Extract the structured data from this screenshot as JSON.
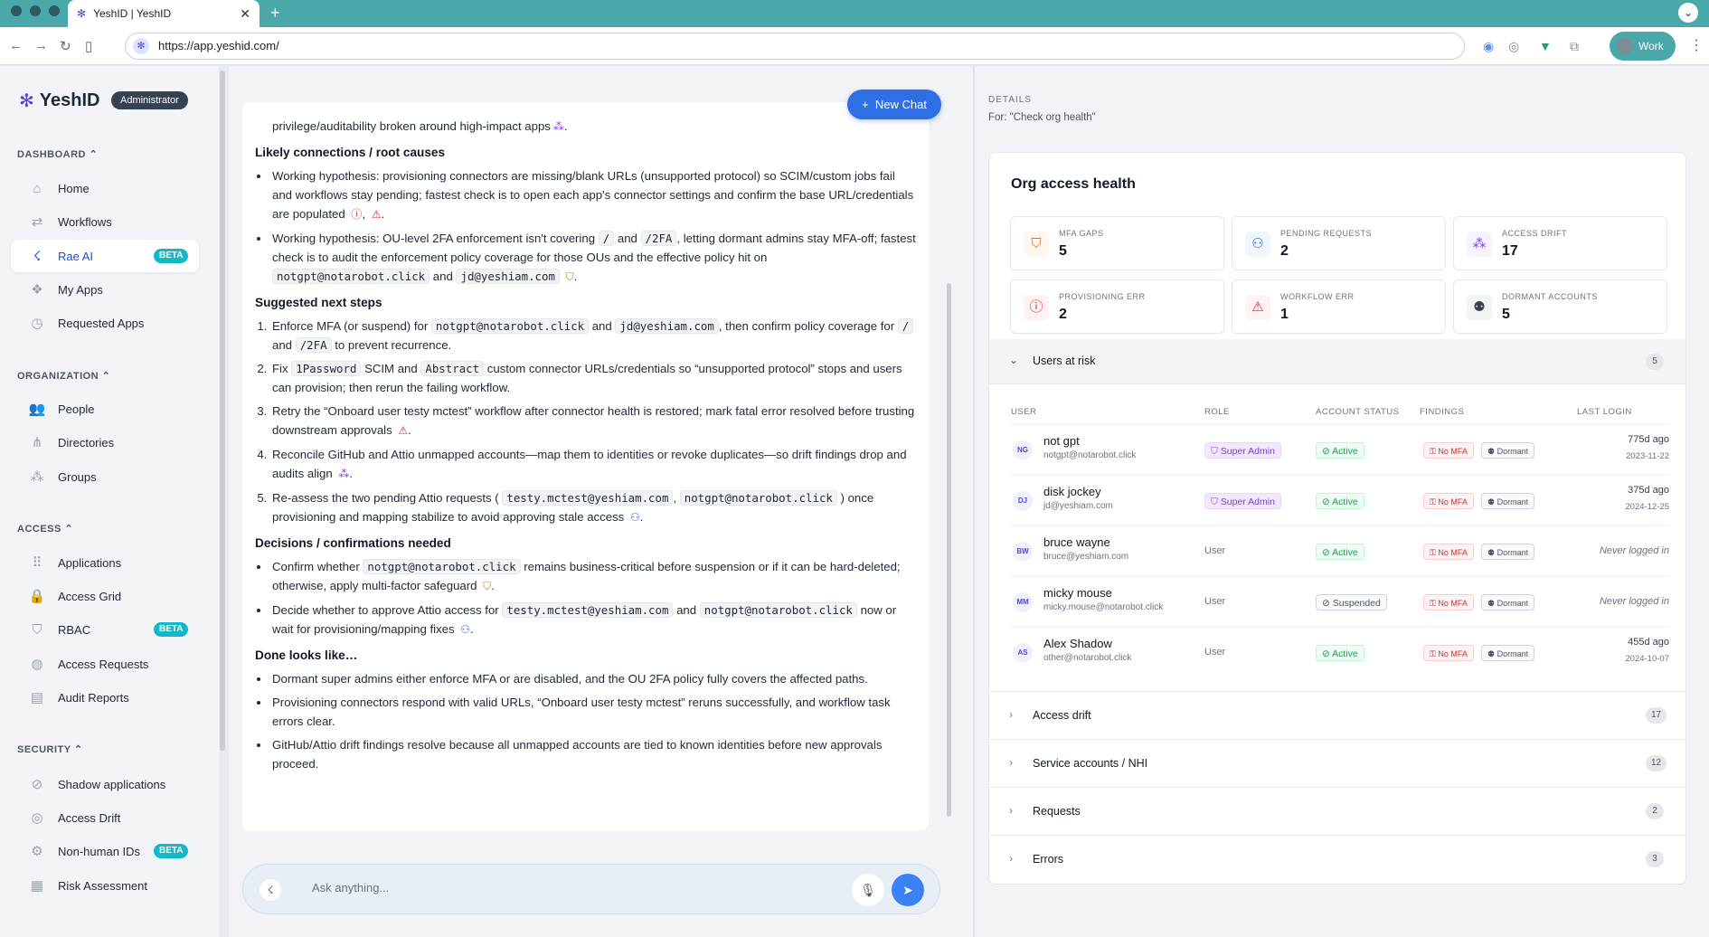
{
  "browser": {
    "tab_title": "YeshID | YeshID",
    "url": "https://app.yeshid.com/",
    "profile": "Work"
  },
  "sidebar": {
    "logo": "YeshID",
    "role": "Administrator",
    "sections": [
      {
        "title": "DASHBOARD",
        "items": [
          {
            "label": "Home"
          },
          {
            "label": "Workflows"
          },
          {
            "label": "Rae AI",
            "badge": "BETA",
            "active": true
          },
          {
            "label": "My Apps"
          },
          {
            "label": "Requested Apps"
          }
        ]
      },
      {
        "title": "ORGANIZATION",
        "items": [
          {
            "label": "People"
          },
          {
            "label": "Directories"
          },
          {
            "label": "Groups"
          }
        ]
      },
      {
        "title": "ACCESS",
        "items": [
          {
            "label": "Applications"
          },
          {
            "label": "Access Grid"
          },
          {
            "label": "RBAC",
            "badge": "BETA"
          },
          {
            "label": "Access Requests"
          },
          {
            "label": "Audit Reports"
          }
        ]
      },
      {
        "title": "SECURITY",
        "items": [
          {
            "label": "Shadow applications"
          },
          {
            "label": "Access Drift"
          },
          {
            "label": "Non-human IDs",
            "badge": "BETA"
          },
          {
            "label": "Risk Assessment"
          }
        ]
      }
    ]
  },
  "chat": {
    "new_chat": "New Chat",
    "placeholder": "Ask anything...",
    "first_line": "privilege/auditability broken around high-impact apps",
    "h1": "Likely connections / root causes",
    "h2": "Suggested next steps",
    "h3": "Decisions / confirmations needed",
    "h4": "Done looks like…",
    "c1": {
      "a": "Working hypothesis: provisioning connectors are missing/blank URLs (unsupported protocol) so SCIM/custom jobs fail and workflows stay pending; fastest check is to open each app's connector settings and confirm the base URL/credentials are populated"
    },
    "c2": {
      "a": "Working hypothesis: OU-level 2FA enforcement isn't covering",
      "k1": "/",
      "and": "and",
      "k2": "/2FA",
      "b": ", letting dormant admins stay MFA-off; fastest check is to audit the enforcement policy coverage for those OUs and the effective policy hit on",
      "k3": "notgpt@notarobot.click",
      "k4": "jd@yeshiam.com"
    },
    "s1": {
      "a": "Enforce MFA (or suspend) for",
      "k1": "notgpt@notarobot.click",
      "and": "and",
      "k2": "jd@yeshiam.com",
      "b": ", then confirm policy coverage for",
      "k3": "/",
      "k4": "/2FA",
      "c": "to prevent recurrence."
    },
    "s2": {
      "a": "Fix",
      "k1": "1Password",
      "b": "SCIM and",
      "k2": "Abstract",
      "c": "custom connector URLs/credentials so “unsupported protocol” stops and users can provision; then rerun the failing workflow."
    },
    "s3": {
      "a": "Retry the “Onboard user testy mctest” workflow after connector health is restored; mark fatal error resolved before trusting downstream approvals"
    },
    "s4": {
      "a": "Reconcile GitHub and Attio unmapped accounts—map them to identities or revoke duplicates—so drift findings drop and audits align"
    },
    "s5": {
      "a": "Re-assess the two pending Attio requests (",
      "k1": "testy.mctest@yeshiam.com",
      "k2": "notgpt@notarobot.click",
      "b": ") once provisioning and mapping stabilize to avoid approving stale access"
    },
    "d1": {
      "a": "Confirm whether",
      "k1": "notgpt@notarobot.click",
      "b": "remains business-critical before suspension or if it can be hard-deleted; otherwise, apply multi-factor safeguard"
    },
    "d2": {
      "a": "Decide whether to approve Attio access for",
      "k1": "testy.mctest@yeshiam.com",
      "and": "and",
      "k2": "notgpt@notarobot.click",
      "b": "now or wait for provisioning/mapping fixes"
    },
    "done": [
      "Dormant super admins either enforce MFA or are disabled, and the OU 2FA policy fully covers the affected paths.",
      "Provisioning connectors respond with valid URLs, “Onboard user testy mctest” reruns successfully, and workflow task errors clear.",
      "GitHub/Attio drift findings resolve because all unmapped accounts are tied to known identities before new approvals proceed."
    ]
  },
  "details": {
    "label": "DETAILS",
    "for": "For: \"Check org health\"",
    "title": "Org access health",
    "stats": [
      {
        "label": "MFA GAPS",
        "value": "5"
      },
      {
        "label": "PENDING REQUESTS",
        "value": "2"
      },
      {
        "label": "ACCESS DRIFT",
        "value": "17"
      },
      {
        "label": "PROVISIONING ERR",
        "value": "2"
      },
      {
        "label": "WORKFLOW ERR",
        "value": "1"
      },
      {
        "label": "DORMANT ACCOUNTS",
        "value": "5"
      }
    ],
    "users_at_risk": {
      "title": "Users at risk",
      "count": "5",
      "columns": [
        "USER",
        "ROLE",
        "ACCOUNT STATUS",
        "FINDINGS",
        "LAST LOGIN"
      ],
      "rows": [
        {
          "initials": "NG",
          "name": "not gpt",
          "email": "notgpt@notarobot.click",
          "role": "Super Admin",
          "status": "Active",
          "f1": "No MFA",
          "f2": "Dormant",
          "last": "775d ago",
          "date": "2023-11-22"
        },
        {
          "initials": "DJ",
          "name": "disk jockey",
          "email": "jd@yeshiam.com",
          "role": "Super Admin",
          "status": "Active",
          "f1": "No MFA",
          "f2": "Dormant",
          "last": "375d ago",
          "date": "2024-12-25"
        },
        {
          "initials": "BW",
          "name": "bruce wayne",
          "email": "bruce@yeshiam.com",
          "role": "User",
          "status": "Active",
          "f1": "No MFA",
          "f2": "Dormant",
          "never": "Never logged in"
        },
        {
          "initials": "MM",
          "name": "micky mouse",
          "email": "micky.mouse@notarobot.click",
          "role": "User",
          "status": "Suspended",
          "f1": "No MFA",
          "f2": "Dormant",
          "never": "Never logged in"
        },
        {
          "initials": "AS",
          "name": "Alex Shadow",
          "email": "other@notarobot.click",
          "role": "User",
          "status": "Active",
          "f1": "No MFA",
          "f2": "Dormant",
          "last": "455d ago",
          "date": "2024-10-07"
        }
      ]
    },
    "sections": [
      {
        "title": "Access drift",
        "count": "17"
      },
      {
        "title": "Service accounts / NHI",
        "count": "12"
      },
      {
        "title": "Requests",
        "count": "2"
      },
      {
        "title": "Errors",
        "count": "3"
      }
    ]
  }
}
